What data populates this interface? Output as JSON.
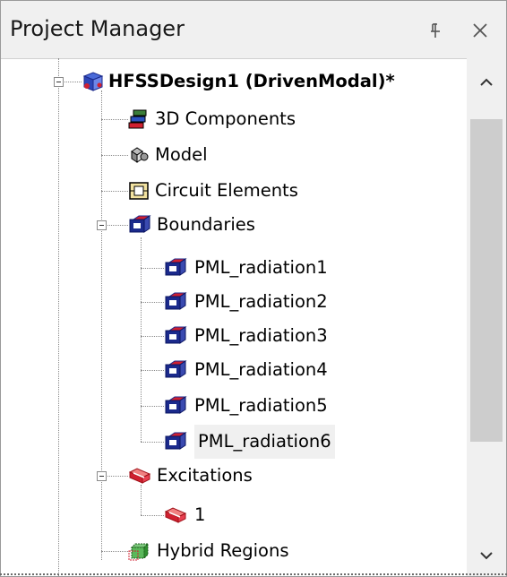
{
  "panel": {
    "title": "Project Manager",
    "pin_icon": "pin-icon",
    "close_icon": "close-icon"
  },
  "tree": {
    "design": {
      "label": "HFSSDesign1 (DrivenModal)*",
      "icon": "hfss-design-icon",
      "expanded": true
    },
    "items": [
      {
        "label": "3D Components",
        "icon": "3d-components-icon"
      },
      {
        "label": "Model",
        "icon": "model-icon"
      },
      {
        "label": "Circuit Elements",
        "icon": "circuit-elements-icon"
      },
      {
        "label": "Boundaries",
        "icon": "boundaries-icon",
        "expanded": true
      },
      {
        "label": "PML_radiation1",
        "icon": "boundary-icon"
      },
      {
        "label": "PML_radiation2",
        "icon": "boundary-icon"
      },
      {
        "label": "PML_radiation3",
        "icon": "boundary-icon"
      },
      {
        "label": "PML_radiation4",
        "icon": "boundary-icon"
      },
      {
        "label": "PML_radiation5",
        "icon": "boundary-icon"
      },
      {
        "label": "PML_radiation6",
        "icon": "boundary-icon",
        "selected": true
      },
      {
        "label": "Excitations",
        "icon": "excitations-icon",
        "expanded": true
      },
      {
        "label": "1",
        "icon": "excitation-icon"
      },
      {
        "label": "Hybrid Regions",
        "icon": "hybrid-regions-icon"
      }
    ]
  },
  "colors": {
    "boundary_blue": "#1b2a8c",
    "boundary_red": "#c0202a",
    "excitation_red": "#d0202a",
    "hybrid_green": "#2f8f2f",
    "scroll_thumb": "#cdcdcd",
    "titlebar_bg": "#f0f0f0"
  }
}
